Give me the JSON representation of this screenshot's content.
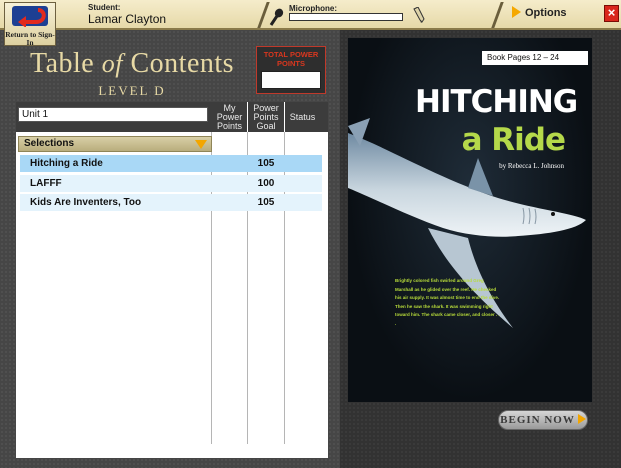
{
  "topbar": {
    "return_label": "Return to Sign-In",
    "student_label": "Student:",
    "student_name": "Lamar Clayton",
    "microphone_label": "Microphone:",
    "microphone_level": 0,
    "options_label": "Options",
    "close_label": "×"
  },
  "toc": {
    "title_pre": "Table",
    "title_of": "of",
    "title_post": "Contents",
    "level": "LEVEL D",
    "total_power_points_label": "TOTAL POWER POINTS",
    "total_power_points_value": "",
    "unit_selected": "Unit 1",
    "columns": {
      "my_power_points": "My Power Points",
      "power_points_goal": "Power Points Goal",
      "status": "Status"
    },
    "selections_label": "Selections",
    "rows": [
      {
        "name": "Hitching a Ride",
        "my_points": "",
        "goal": "105",
        "status": "",
        "selected": true
      },
      {
        "name": "LAFFF",
        "my_points": "",
        "goal": "100",
        "status": "",
        "selected": false
      },
      {
        "name": "Kids Are Inventers, Too",
        "my_points": "",
        "goal": "105",
        "status": "",
        "selected": false
      }
    ]
  },
  "book": {
    "pages": "Book Pages 12 – 24",
    "title_line1": "HITCHING",
    "title_line2": "a Ride",
    "author": "by Rebecca L. Johnson",
    "excerpt": "Brightly colored fish swirled around Greg Marshall as he glided over the reef. He checked his air supply. It was almost time to end the dive. Then he saw the shark. It was swimming right toward him. The shark came closer, and closer . . ."
  },
  "begin_button": "BEGIN NOW",
  "colors": {
    "accent_yellow": "#f3a600",
    "title_gold": "#e7d9a5",
    "selected_row": "#a9d8f6",
    "close_red": "#d9261c",
    "book_green": "#b5d94a"
  }
}
